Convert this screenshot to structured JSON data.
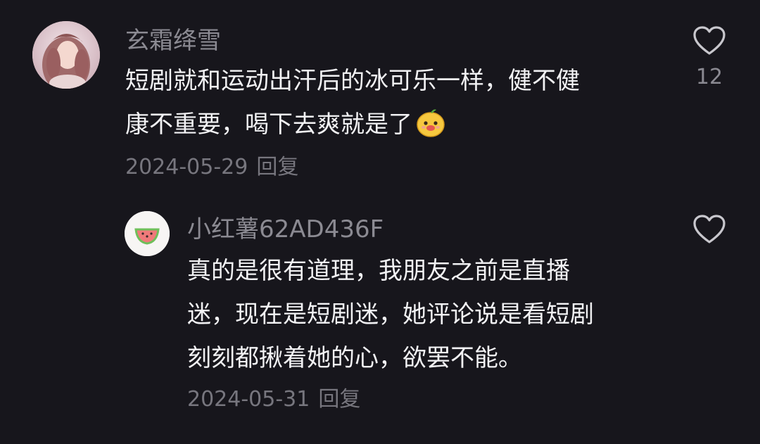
{
  "comments": [
    {
      "username": "玄霜绛雪",
      "text": "短剧就和运动出汗后的冰可乐一样，健不健\n康不重要，喝下去爽就是了",
      "emoji": "smiling-pear-face-emoji",
      "date": "2024-05-29",
      "reply_label": "回复",
      "likes": "12",
      "avatar_icon": "profile-photo"
    }
  ],
  "replies": [
    {
      "username": "小红薯62AD436F",
      "text": "真的是很有道理，我朋友之前是直播\n迷，现在是短剧迷，她评论说是看短剧\n刻刻都揪着她的心，欲罢不能。",
      "date": "2024-05-31",
      "reply_label": "回复",
      "avatar_icon": "watermelon-icon"
    }
  ],
  "colors": {
    "background": "#17161c",
    "text_primary": "#f2f2f4",
    "text_secondary": "#8b8a92",
    "heart_outline": "#c8c7cd"
  }
}
